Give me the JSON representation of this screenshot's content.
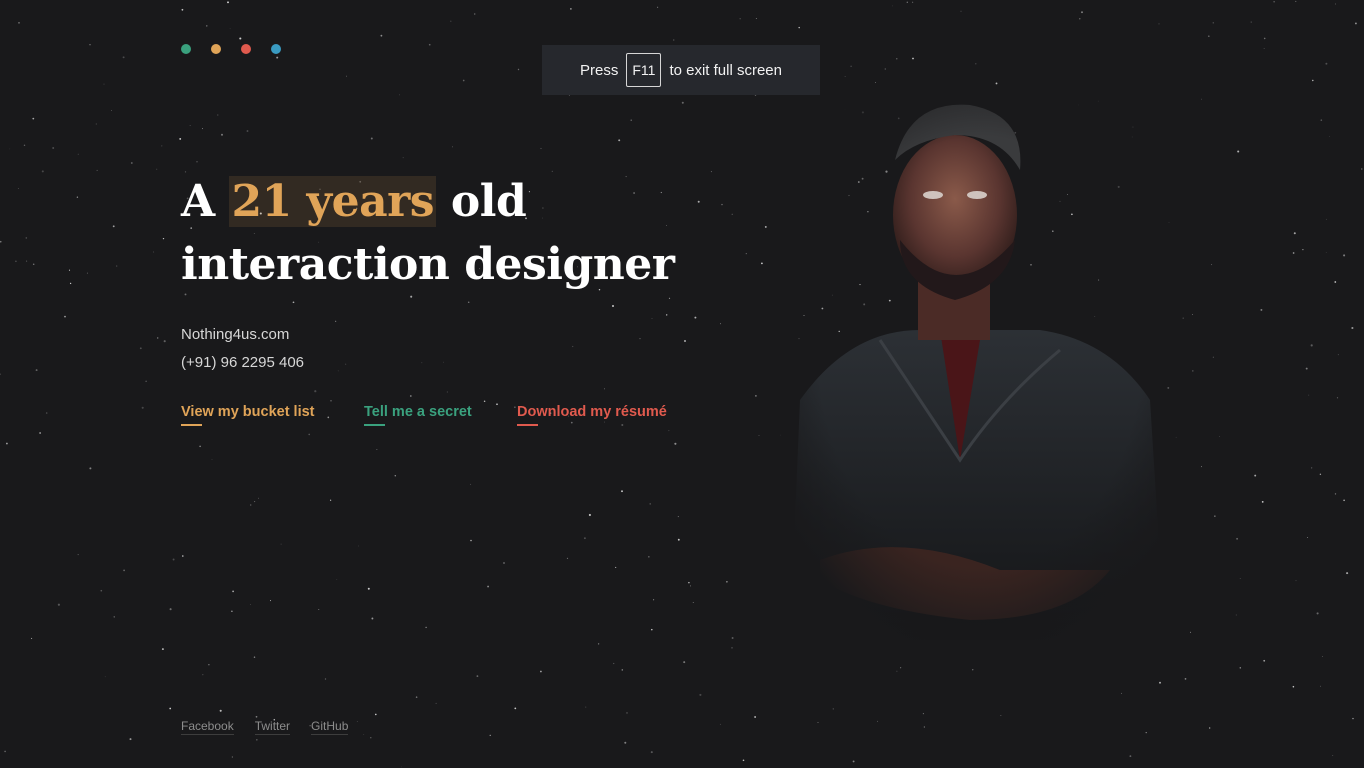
{
  "window_dots": [
    {
      "name": "green",
      "color": "#3aa17e"
    },
    {
      "name": "orange",
      "color": "#e0a458"
    },
    {
      "name": "red",
      "color": "#e05a4e"
    },
    {
      "name": "blue",
      "color": "#3a9bc2"
    }
  ],
  "fullscreen_notice": {
    "prefix": "Press",
    "key": "F11",
    "suffix": "to exit full screen"
  },
  "hero": {
    "line1_a": "A",
    "line1_highlight": "21 years",
    "line1_b": "old",
    "line2": "interaction designer"
  },
  "contact": {
    "website": "Nothing4us.com",
    "phone": "(+91) 96 2295 406"
  },
  "links": [
    {
      "label": "View my bucket list",
      "color": "#e0a458"
    },
    {
      "label": "Tell me a secret",
      "color": "#3aa17e"
    },
    {
      "label": "Download my résumé",
      "color": "#e05a4e"
    }
  ],
  "social": {
    "facebook": "Facebook",
    "twitter": "Twitter",
    "github": "GitHub"
  },
  "colors": {
    "background": "#19191b",
    "accent_orange": "#e0a458",
    "accent_green": "#3aa17e",
    "accent_red": "#e05a4e"
  }
}
